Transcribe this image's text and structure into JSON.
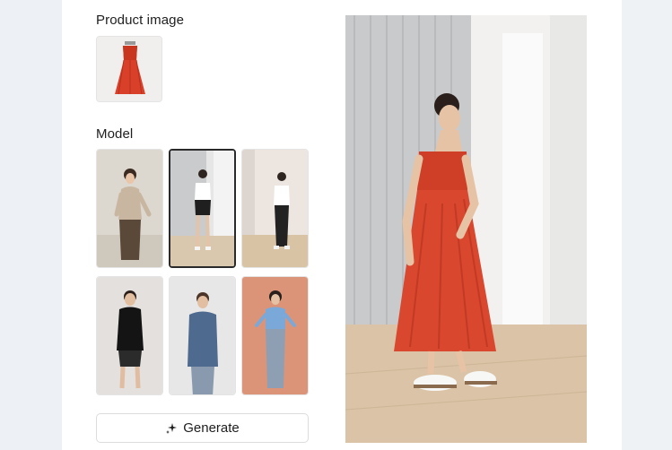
{
  "product_section": {
    "title": "Product image"
  },
  "model_section": {
    "title": "Model",
    "selected_index": 1
  },
  "generate_button": {
    "label": "Generate",
    "icon": "sparkle-icon"
  },
  "colors": {
    "accent_dress": "#d9472f",
    "panel_bg": "#ffffff",
    "page_bg": "#edf0f5"
  }
}
